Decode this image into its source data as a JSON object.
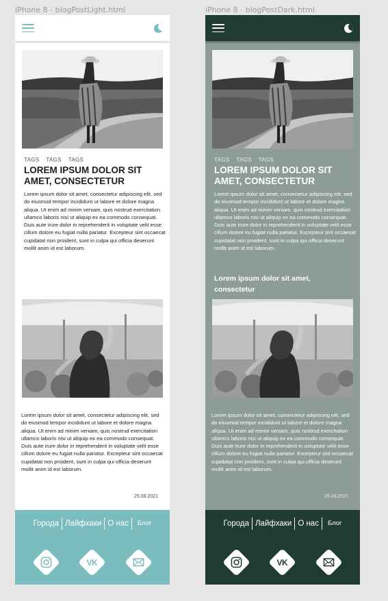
{
  "frames": [
    {
      "id": "light",
      "label": "iPhone 8 - blogPostLight.html",
      "theme": "light",
      "accent": "#7bbcbf",
      "tags": [
        "TAGS",
        "TAGS",
        "TAGS"
      ],
      "title": "LOREM IPSUM DOLOR SIT AMET, CONSECTETUR",
      "paragraph1": "Lorem ipsum dolor sit amet, consectetur adipiscing elit, sed do eiusmod tempor incididunt ut labore et dolore magna aliqua. Ut enim ad minim veniam, quis nostrud exercitation ullamco laboris nisi ut aliquip ex ea commodo consequat. Duis aute irure dolor in reprehenderit in voluptate velit esse cillum dolore eu fugiat nulla pariatur. Excepteur sint occaecat cupidatat non proident, sunt in culpa qui officia deserunt mollit anim id est laborum.",
      "paragraph2": "Lorem ipsum dolor sit amet, consectetur adipiscing elit, sed do eiusmod tempor incididunt ut labore et dolore magna aliqua. Ut enim ad minim veniam, quis nostrud exercitation ullamco laboris nisi ut aliquip ex ea commodo consequat. Duis aute irure dolor in reprehenderit in voluptate velit esse cillum dolore eu fugiat nulla pariatur. Excepteur sint occaecat cupidatat non proident, sunt in culpa qui officia deserunt mollit anim id est laborum.",
      "date": "25.08.2021",
      "nav": [
        "Города",
        "Лайфхаки",
        "О нас",
        "Блог"
      ],
      "socials": [
        "instagram-icon",
        "vk-icon",
        "mail-icon"
      ]
    },
    {
      "id": "dark",
      "label": "iPhone 8 - blogPostDark.html",
      "theme": "dark",
      "accent": "#1f3b34",
      "tags": [
        "TAGS",
        "TAGS",
        "TAGS"
      ],
      "title": "LOREM IPSUM DOLOR SIT AMET, CONSECTETUR",
      "paragraph1": "Lorem ipsum dolor sit amet, consectetur adipiscing elit, sed do eiusmod tempor incididunt ut labore et dolore magna aliqua. Ut enim ad minim veniam, quis nostrud exercitation ullamco laboris nisi ut aliquip ex ea commodo consequat. Duis aute irure dolor in reprehenderit in voluptate velit esse cillum dolore eu fugiat nulla pariatur. Excepteur sint occaecat cupidatat non proident, sunt in culpa qui officia deserunt mollit anim id est laborum.",
      "subheading": "Lorem ipsum dolor sit amet, consectetur",
      "paragraph2": "Lorem ipsum dolor sit amet, consectetur adipiscing elit, sed do eiusmod tempor incididunt ut labore et dolore magna aliqua. Ut enim ad minim veniam, quis nostrud exercitation ullamco laboris nisi ut aliquip ex ea commodo consequat. Duis aute irure dolor in reprehenderit in voluptate velit esse cillum dolore eu fugiat nulla pariatur. Excepteur sint occaecat cupidatat non proident, sunt in culpa qui officia deserunt mollit anim id est laborum.",
      "date": "25.08.2021",
      "nav": [
        "Города",
        "Лайфхаки",
        "О нас",
        "Блог"
      ],
      "socials": [
        "instagram-icon",
        "vk-icon",
        "mail-icon"
      ]
    }
  ],
  "vk_label": "VK"
}
